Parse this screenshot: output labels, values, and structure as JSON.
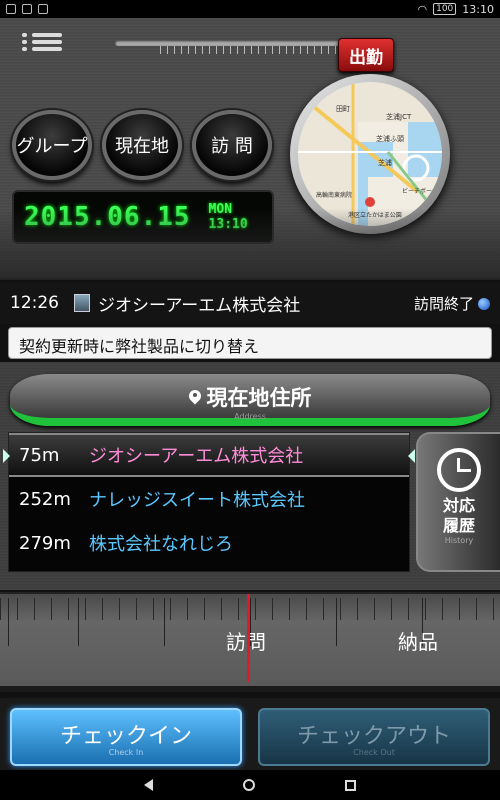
{
  "status_bar": {
    "battery": "100",
    "time": "13:10"
  },
  "top": {
    "shukkin_label": "出勤",
    "buttons": [
      {
        "label": "グループ"
      },
      {
        "label": "現在地"
      },
      {
        "label": "訪 問"
      }
    ],
    "clock": {
      "date": "2015.06.15",
      "day_time": "MON 13:10"
    },
    "map": {
      "labels": [
        "田町",
        "芝浦JCT",
        "芝浦ふ頭",
        "高輪南東病院",
        "芝浦",
        "港区立たかはま公園",
        "ビーチボール"
      ]
    }
  },
  "visit": {
    "time": "12:26",
    "company": "ジオシーアーエム株式会社",
    "status": "訪問終了"
  },
  "memo": "契約更新時に弊社製品に切り替え",
  "address_bar": {
    "label": "現在地住所",
    "sub": "Address"
  },
  "nearby": [
    {
      "distance": "75m",
      "name": "ジオシーアーエム株式会社"
    },
    {
      "distance": "252m",
      "name": "ナレッジスイート株式会社"
    },
    {
      "distance": "279m",
      "name": "株式会社なれじろ"
    }
  ],
  "history": {
    "line1": "対応",
    "line2": "履歴",
    "sub": "History"
  },
  "ruler": {
    "left_label": "訪問",
    "right_label": "納品"
  },
  "actions": {
    "checkin": "チェックイン",
    "checkin_sub": "Check In",
    "checkout": "チェックアウト",
    "checkout_sub": "Check Out"
  }
}
